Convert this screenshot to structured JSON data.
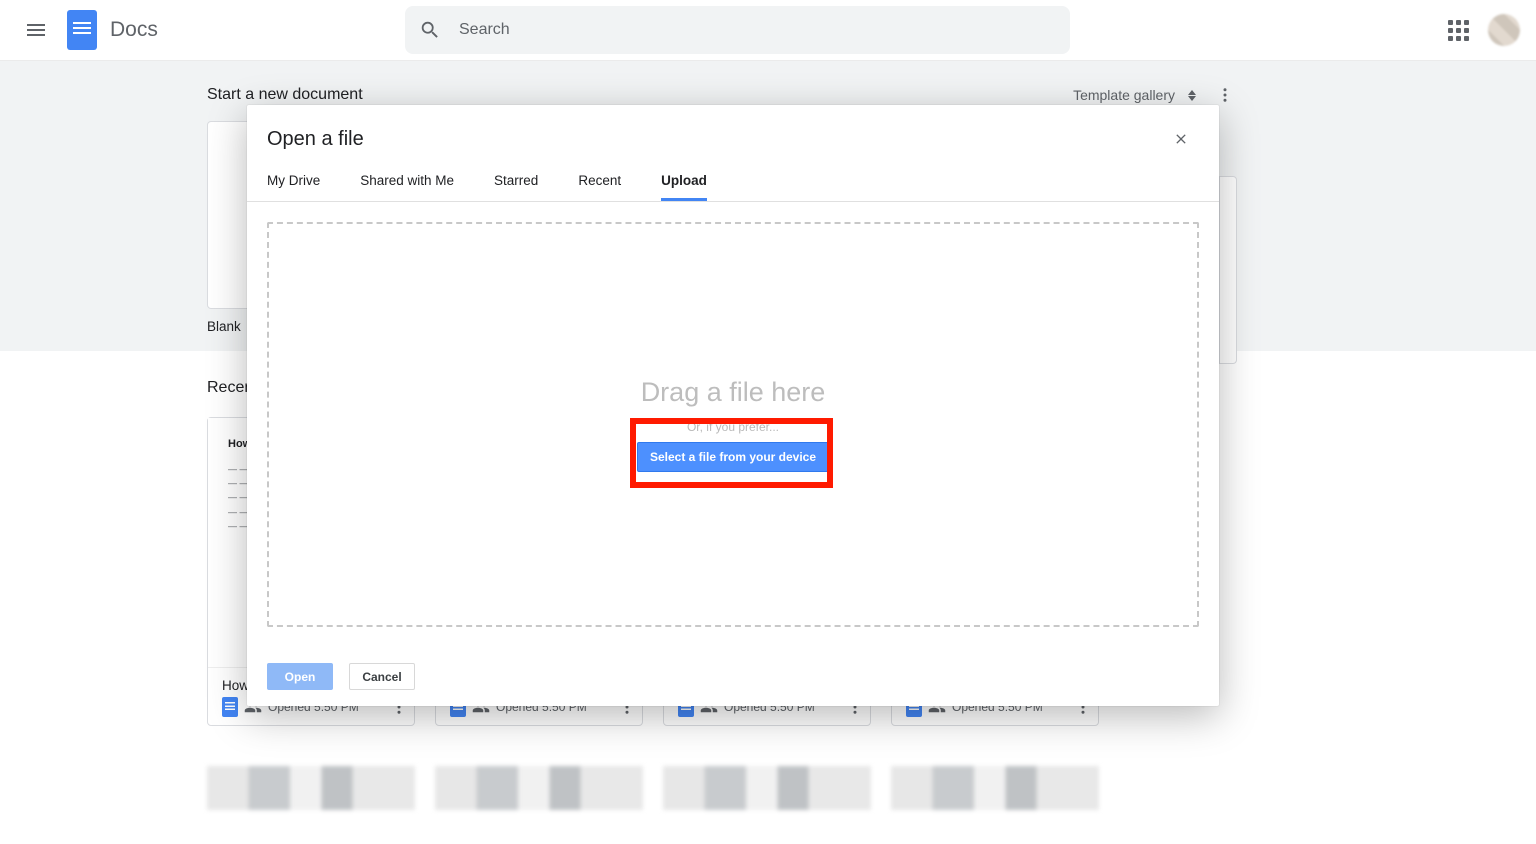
{
  "header": {
    "app_name": "Docs",
    "search_placeholder": "Search"
  },
  "start_section": {
    "title": "Start a new document",
    "template_gallery_label": "Template gallery",
    "blank_label": "Blank"
  },
  "recent_section": {
    "title": "Recent documents",
    "doc_prefix": "How",
    "opened_text": "Opened 5:50 PM"
  },
  "modal": {
    "title": "Open a file",
    "tabs": [
      "My Drive",
      "Shared with Me",
      "Starred",
      "Recent",
      "Upload"
    ],
    "active_tab_index": 4,
    "drag_text": "Drag a file here",
    "prefer_text": "Or, if you prefer...",
    "select_button": "Select a file from your device",
    "open_button": "Open",
    "cancel_button": "Cancel"
  }
}
